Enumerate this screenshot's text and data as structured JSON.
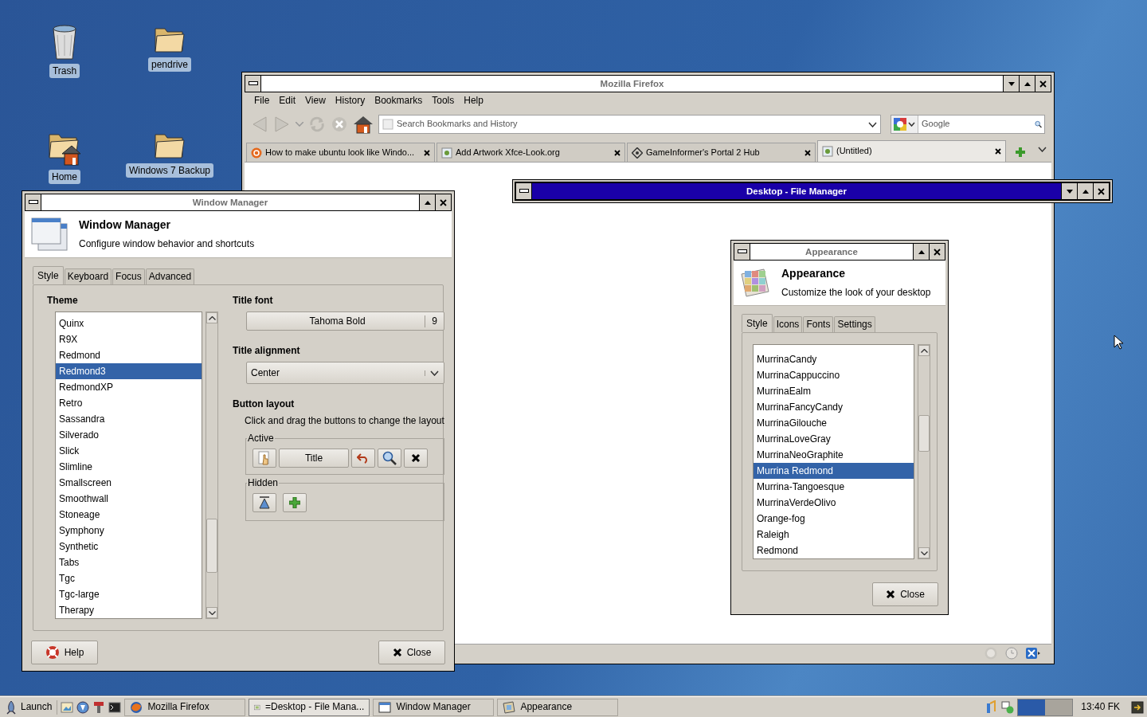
{
  "desktop_icons": [
    {
      "label": "Trash",
      "kind": "trash"
    },
    {
      "label": "pendrive",
      "kind": "folder"
    },
    {
      "label": "Home",
      "kind": "home"
    },
    {
      "label": "Windows 7 Backup",
      "kind": "folder"
    }
  ],
  "firefox": {
    "title": "Mozilla Firefox",
    "active": false,
    "menu": [
      "File",
      "Edit",
      "View",
      "History",
      "Bookmarks",
      "Tools",
      "Help"
    ],
    "address": {
      "placeholder": "Search Bookmarks and History"
    },
    "search": {
      "placeholder": "Google"
    },
    "tabs": [
      {
        "label": "How to make ubuntu look like Windo...",
        "selected": false
      },
      {
        "label": "Add Artwork Xfce-Look.org",
        "selected": false
      },
      {
        "label": "GameInformer's Portal 2 Hub",
        "selected": false
      },
      {
        "label": "(Untitled)",
        "selected": true
      }
    ]
  },
  "window_manager": {
    "title": "Window Manager",
    "active": false,
    "header_title": "Window Manager",
    "header_subtitle": "Configure window behavior and shortcuts",
    "tabs": [
      {
        "label": "Style",
        "selected": true
      },
      {
        "label": "Keyboard",
        "selected": false
      },
      {
        "label": "Focus",
        "selected": false
      },
      {
        "label": "Advanced",
        "selected": false
      }
    ],
    "theme_label": "Theme",
    "themes": [
      {
        "label": "Quinx",
        "selected": false
      },
      {
        "label": "R9X",
        "selected": false
      },
      {
        "label": "Redmond",
        "selected": false
      },
      {
        "label": "Redmond3",
        "selected": true
      },
      {
        "label": "RedmondXP",
        "selected": false
      },
      {
        "label": "Retro",
        "selected": false
      },
      {
        "label": "Sassandra",
        "selected": false
      },
      {
        "label": "Silverado",
        "selected": false
      },
      {
        "label": "Slick",
        "selected": false
      },
      {
        "label": "Slimline",
        "selected": false
      },
      {
        "label": "Smallscreen",
        "selected": false
      },
      {
        "label": "Smoothwall",
        "selected": false
      },
      {
        "label": "Stoneage",
        "selected": false
      },
      {
        "label": "Symphony",
        "selected": false
      },
      {
        "label": "Synthetic",
        "selected": false
      },
      {
        "label": "Tabs",
        "selected": false
      },
      {
        "label": "Tgc",
        "selected": false
      },
      {
        "label": "Tgc-large",
        "selected": false
      },
      {
        "label": "Therapy",
        "selected": false
      }
    ],
    "title_font_label": "Title font",
    "font_name": "Tahoma Bold",
    "font_size": "9",
    "title_alignment_label": "Title alignment",
    "alignment": "Center",
    "button_layout_label": "Button layout",
    "button_layout_hint": "Click and drag the buttons to change the layout",
    "active_label": "Active",
    "title_button": "Title",
    "hidden_label": "Hidden",
    "help_button": "Help",
    "close_button": "Close"
  },
  "file_manager": {
    "title": "Desktop - File Manager",
    "active": true
  },
  "appearance": {
    "title": "Appearance",
    "active": false,
    "header_title": "Appearance",
    "header_subtitle": "Customize the look of your desktop",
    "tabs": [
      {
        "label": "Style",
        "selected": true
      },
      {
        "label": "Icons",
        "selected": false
      },
      {
        "label": "Fonts",
        "selected": false
      },
      {
        "label": "Settings",
        "selected": false
      }
    ],
    "themes": [
      {
        "label": "MurrinaCandy",
        "selected": false
      },
      {
        "label": "MurrinaCappuccino",
        "selected": false
      },
      {
        "label": "MurrinaEalm",
        "selected": false
      },
      {
        "label": "MurrinaFancyCandy",
        "selected": false
      },
      {
        "label": "MurrinaGilouche",
        "selected": false
      },
      {
        "label": "MurrinaLoveGray",
        "selected": false
      },
      {
        "label": "MurrinaNeoGraphite",
        "selected": false
      },
      {
        "label": "Murrina Redmond",
        "selected": true
      },
      {
        "label": "Murrina-Tangoesque",
        "selected": false
      },
      {
        "label": "MurrinaVerdeOlivo",
        "selected": false
      },
      {
        "label": "Orange-fog",
        "selected": false
      },
      {
        "label": "Raleigh",
        "selected": false
      },
      {
        "label": "Redmond",
        "selected": false
      }
    ],
    "close_button": "Close"
  },
  "taskbar": {
    "launch": "Launch",
    "tasks": [
      {
        "label": "Mozilla Firefox",
        "selected": false
      },
      {
        "label": "=Desktop - File Mana...",
        "selected": true
      },
      {
        "label": "Window Manager",
        "selected": false
      },
      {
        "label": "Appearance",
        "selected": false
      }
    ],
    "clock": "13:40 FK"
  }
}
